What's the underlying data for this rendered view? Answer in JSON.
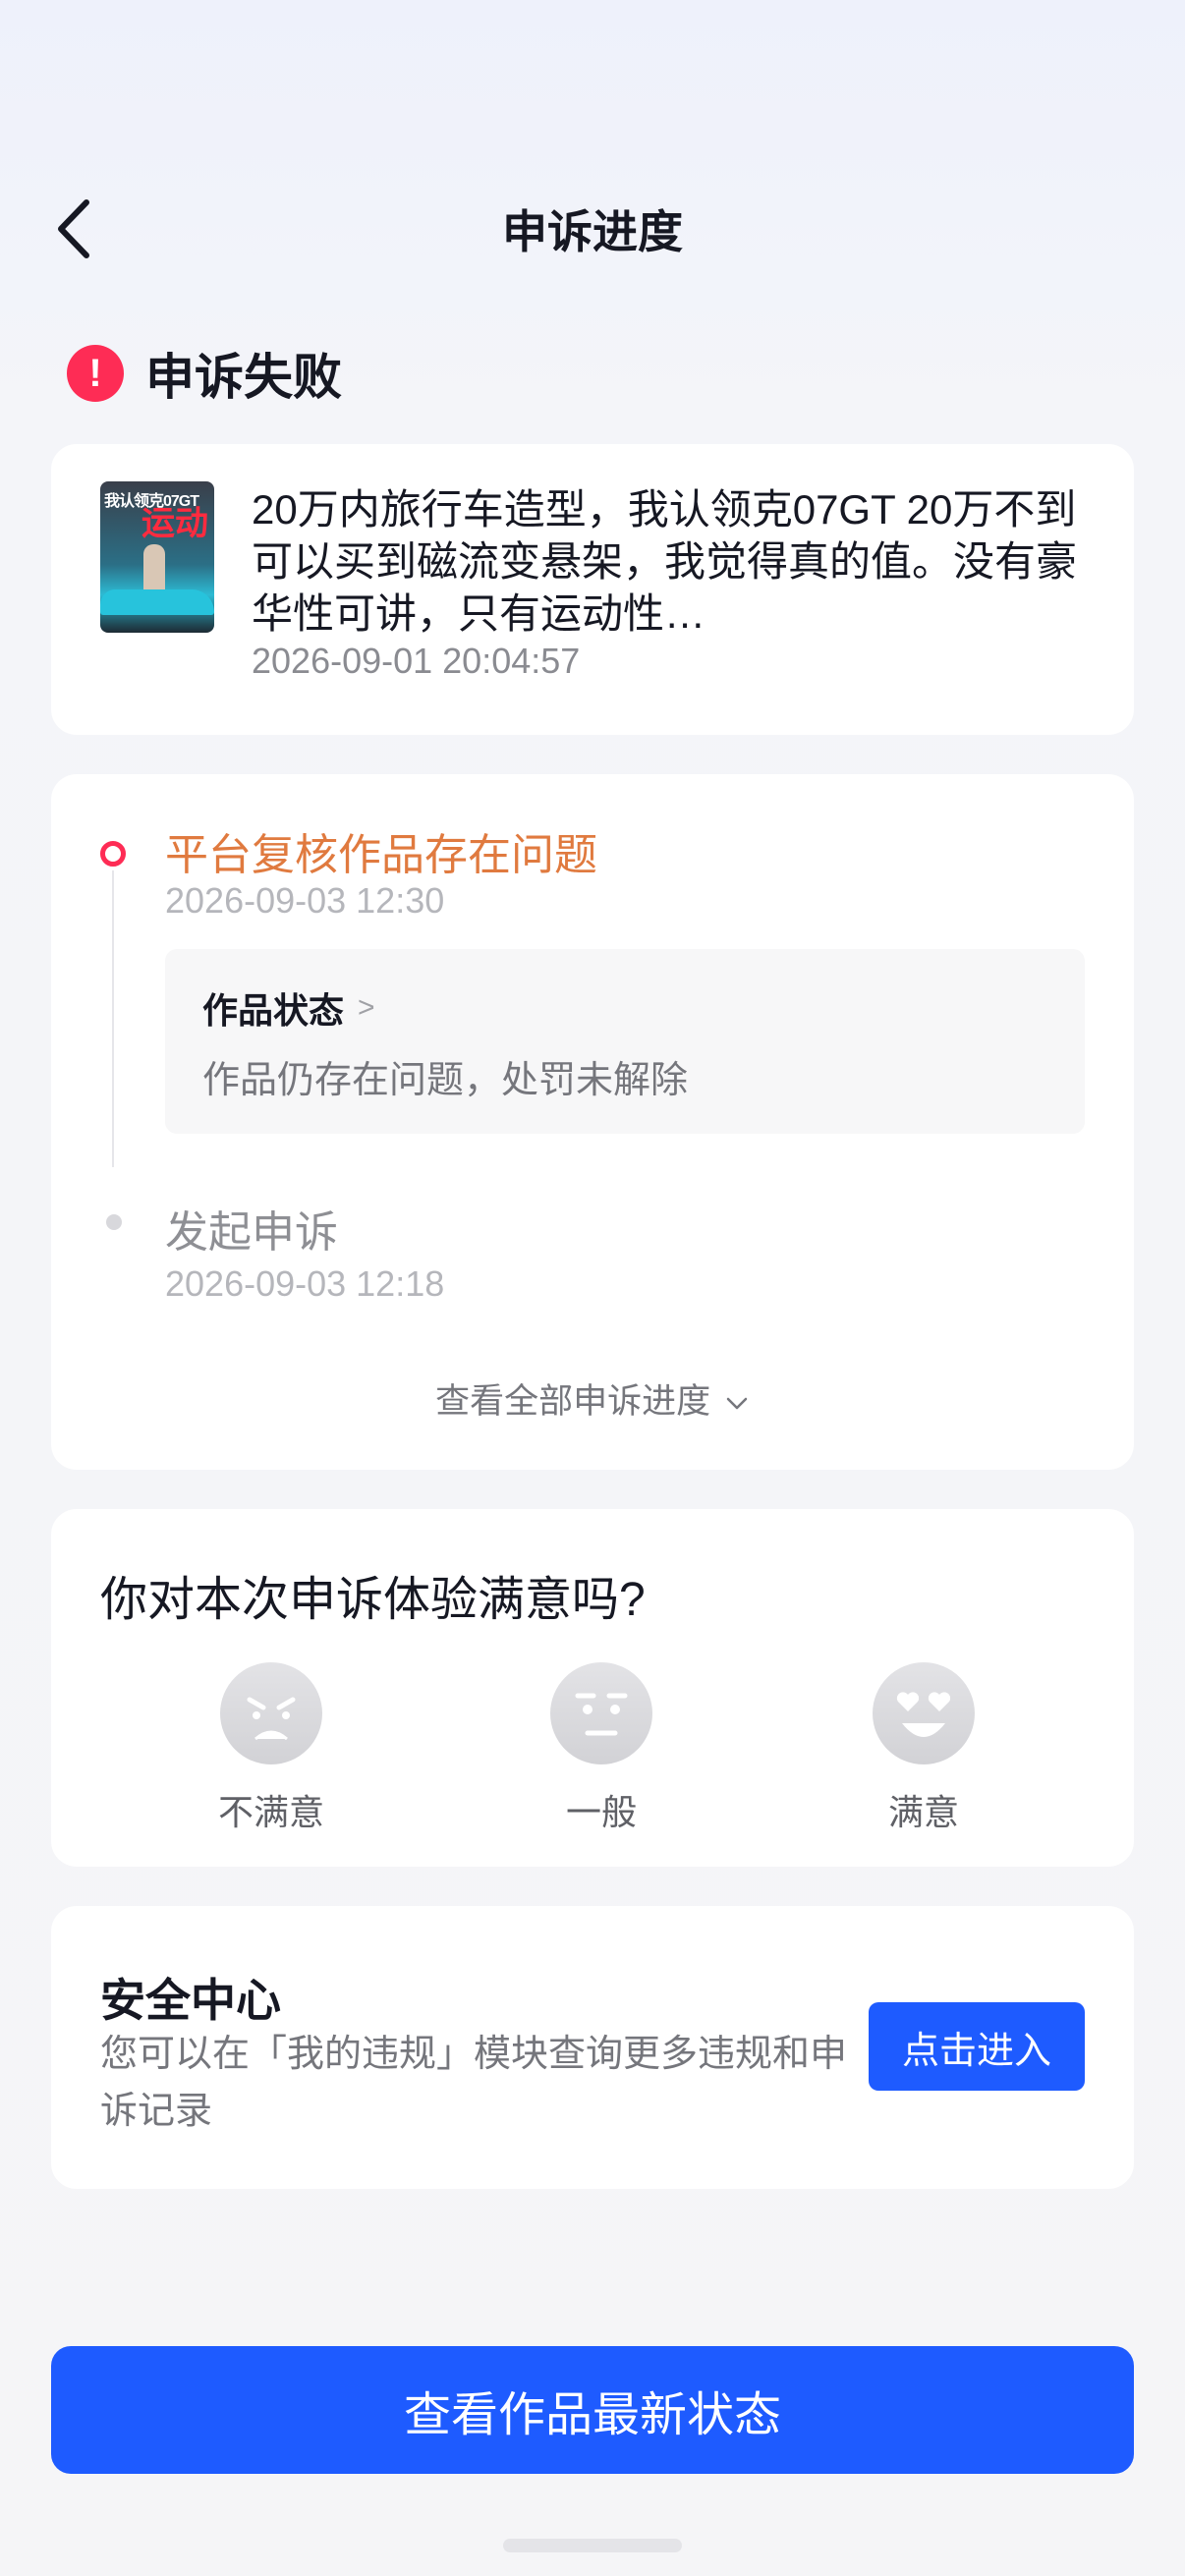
{
  "header": {
    "title": "申诉进度"
  },
  "status": {
    "text": "申诉失败",
    "icon": "exclamation-icon",
    "color": "#fe2c55"
  },
  "video": {
    "thumbnail_text_1": "我认领克07GT",
    "thumbnail_text_2": "运动",
    "description": "20万内旅行车造型，我认领克07GT 20万不到可以买到磁流变悬架，我觉得真的值。没有豪华性可讲，只有运动性…",
    "time": "2026-09-01 20:04:57"
  },
  "progress": {
    "steps": [
      {
        "title": "平台复核作品存在问题",
        "time": "2026-09-03 12:30",
        "detail_title": "作品状态",
        "detail_desc": "作品仍存在问题，处罚未解除"
      },
      {
        "title": "发起申诉",
        "time": "2026-09-03 12:18"
      }
    ],
    "view_all": "查看全部申诉进度",
    "accent_color": "#e07a3f"
  },
  "survey": {
    "question": "你对本次申诉体验满意吗?",
    "options": [
      "不满意",
      "一般",
      "满意"
    ]
  },
  "safety": {
    "title": "安全中心",
    "desc": "您可以在「我的违规」模块查询更多违规和申诉记录",
    "button": "点击进入"
  },
  "main_button": {
    "label": "查看作品最新状态",
    "color": "#1e5bff"
  }
}
